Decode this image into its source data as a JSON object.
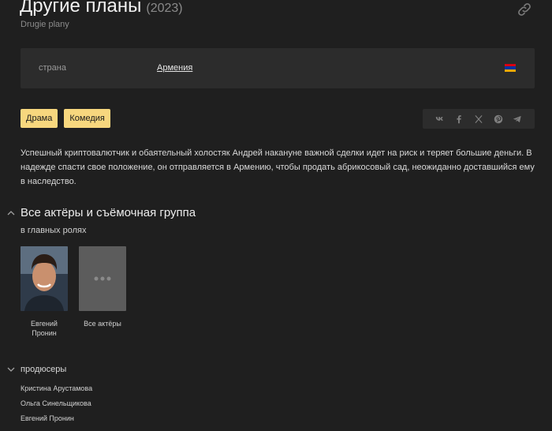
{
  "film": {
    "title": "Другие планы",
    "year": "(2023)",
    "original_title": "Drugie plany"
  },
  "info": {
    "country_label": "страна",
    "country_value": "Армения",
    "flag_colors": [
      "#d90012",
      "#0033a0",
      "#f2a800"
    ]
  },
  "genres": [
    "Драма",
    "Комедия"
  ],
  "share": {
    "icons": [
      "vk-icon",
      "facebook-icon",
      "x-icon",
      "pinterest-icon",
      "telegram-icon"
    ]
  },
  "description": "Успешный криптовалютчик и обаятельный холостяк Андрей накануне важной сделки идет на риск и теряет большие деньги. В надежде спасти свое положение, он отправляется в Армению, чтобы продать абрикосовый сад, неожиданно доставшийся ему в наследство.",
  "cast_section": {
    "title": "Все актёры и съёмочная группа",
    "subtitle": "в главных ролях",
    "actors": [
      {
        "name": "Евгений Пронин"
      }
    ],
    "all_actors_label": "Все актёры"
  },
  "producers": {
    "title": "продюсеры",
    "people": [
      "Кристина Арустамова",
      "Ольга Синельщикова",
      "Евгений Пронин"
    ]
  },
  "colors": {
    "background": "#1f1f1f",
    "panel": "#2c2c2c",
    "genre_tag": "#f7d77e"
  }
}
